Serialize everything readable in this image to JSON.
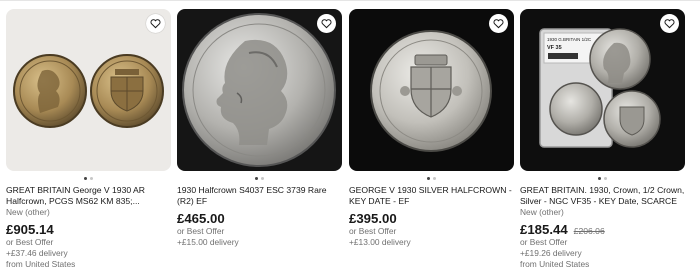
{
  "listings": [
    {
      "title": "GREAT BRITAIN George V 1930 AR Halfcrown, PCGS MS62 KM 835;...",
      "condition": "New (other)",
      "price": "£905.14",
      "was_price": "",
      "best_offer": "or Best Offer",
      "delivery": "+£37.46 delivery",
      "location": "from United States",
      "image_icon": "coin-pair-photo"
    },
    {
      "title": "1930 Halfcrown S4037 ESC 3739 Rare (R2) EF",
      "condition": "",
      "price": "£465.00",
      "was_price": "",
      "best_offer": "or Best Offer",
      "delivery": "+£15.00 delivery",
      "location": "",
      "image_icon": "coin-portrait-photo"
    },
    {
      "title": "GEORGE V 1930 SILVER HALFCROWN - KEY DATE - EF",
      "condition": "",
      "price": "£395.00",
      "was_price": "",
      "best_offer": "or Best Offer",
      "delivery": "+£13.00 delivery",
      "location": "",
      "image_icon": "coin-shield-photo"
    },
    {
      "title": "GREAT BRITAIN. 1930, Crown, 1/2 Crown, Silver - NGC VF35 - KEY Date, SCARCE",
      "condition": "New (other)",
      "price": "£185.44",
      "was_price": "£206.06",
      "best_offer": "or Best Offer",
      "delivery": "+£19.26 delivery",
      "location": "from United States",
      "image_icon": "slabbed-coin-photo"
    }
  ],
  "slab_label": "1930 G.BRITAIN 1/2C",
  "slab_grade": "VF 35",
  "colors": {
    "price": "#191919",
    "muted": "#707070",
    "card_dark": "#111111",
    "card_light": "#f2f2f2"
  }
}
